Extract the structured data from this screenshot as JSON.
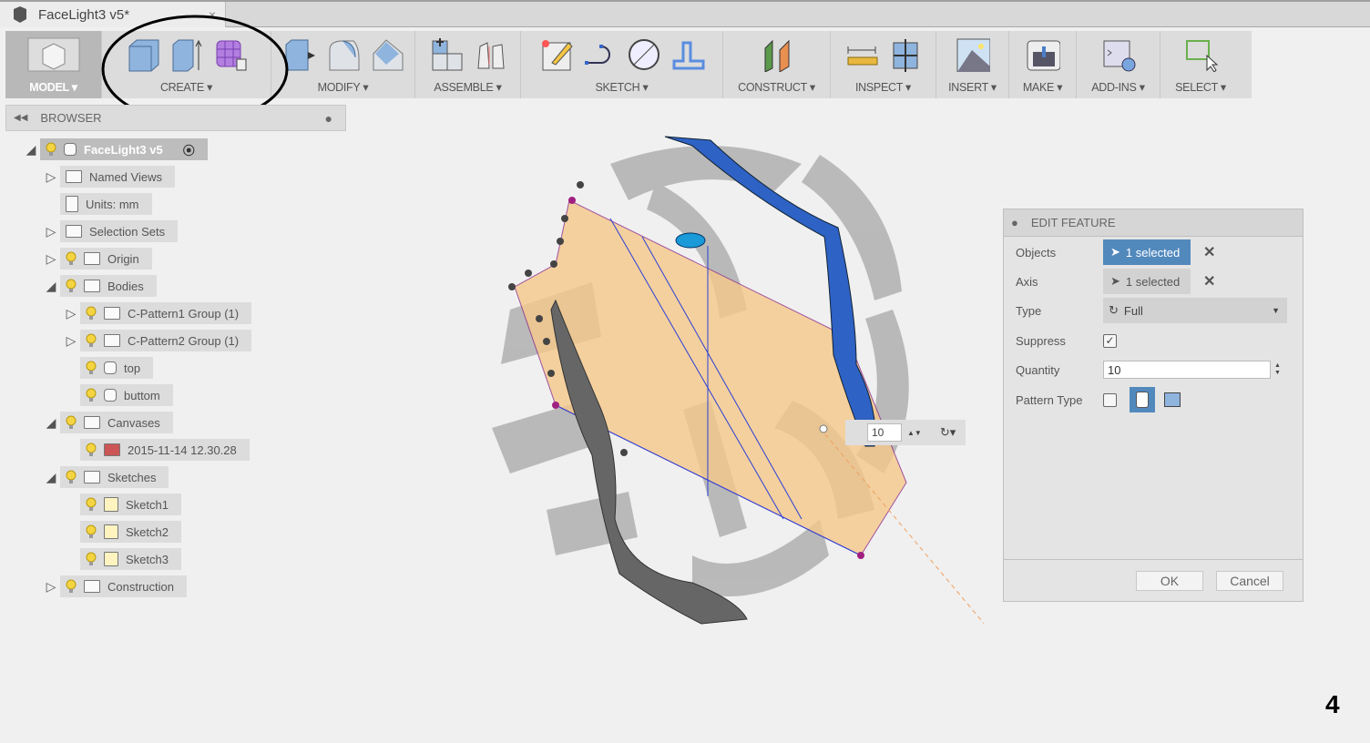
{
  "document": {
    "title": "FaceLight3 v5*",
    "close": "×"
  },
  "toolbar": {
    "groups": [
      {
        "id": "model",
        "label": "MODEL ▾"
      },
      {
        "id": "create",
        "label": "CREATE ▾"
      },
      {
        "id": "modify",
        "label": "MODIFY ▾"
      },
      {
        "id": "assemble",
        "label": "ASSEMBLE ▾"
      },
      {
        "id": "sketch",
        "label": "SKETCH ▾"
      },
      {
        "id": "construct",
        "label": "CONSTRUCT ▾"
      },
      {
        "id": "inspect",
        "label": "INSPECT ▾"
      },
      {
        "id": "insert",
        "label": "INSERT ▾"
      },
      {
        "id": "make",
        "label": "MAKE ▾"
      },
      {
        "id": "addins",
        "label": "ADD-INS ▾"
      },
      {
        "id": "select",
        "label": "SELECT ▾"
      }
    ]
  },
  "browser": {
    "title": "BROWSER",
    "nodes": [
      {
        "label": "FaceLight3 v5"
      },
      {
        "label": "Named Views"
      },
      {
        "label": "Units: mm"
      },
      {
        "label": "Selection Sets"
      },
      {
        "label": "Origin"
      },
      {
        "label": "Bodies"
      },
      {
        "label": "C-Pattern1 Group (1)"
      },
      {
        "label": "C-Pattern2 Group (1)"
      },
      {
        "label": "top"
      },
      {
        "label": "buttom"
      },
      {
        "label": "Canvases"
      },
      {
        "label": "2015-11-14 12.30.28"
      },
      {
        "label": "Sketches"
      },
      {
        "label": "Sketch1"
      },
      {
        "label": "Sketch2"
      },
      {
        "label": "Sketch3"
      },
      {
        "label": "Construction"
      }
    ]
  },
  "viewport": {
    "quantity_input": "10"
  },
  "edit_feature": {
    "title": "EDIT FEATURE",
    "objects": {
      "label": "Objects",
      "value": "1 selected"
    },
    "axis": {
      "label": "Axis",
      "value": "1 selected"
    },
    "type": {
      "label": "Type",
      "value": "Full"
    },
    "suppress": {
      "label": "Suppress",
      "checked": true
    },
    "quantity": {
      "label": "Quantity",
      "value": "10"
    },
    "pattern_type": {
      "label": "Pattern Type"
    },
    "ok": "OK",
    "cancel": "Cancel"
  },
  "annotation": "4",
  "colors": {
    "selected": "#5289bd",
    "accent_body": "#f5c98a",
    "blue_body": "#2e62c4"
  }
}
